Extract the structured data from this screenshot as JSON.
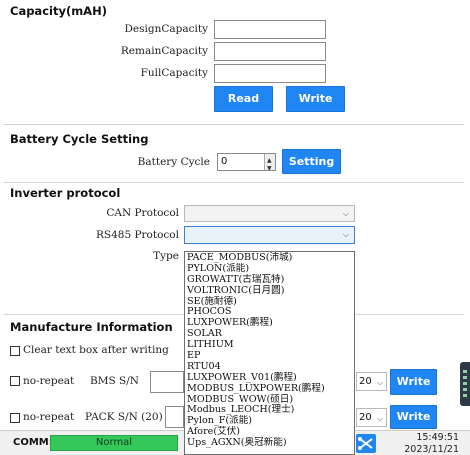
{
  "capacity": {
    "title": "Capacity(mAH)",
    "design_label": "DesignCapacity",
    "design_value": "",
    "remain_label": "RemainCapacity",
    "remain_value": "",
    "full_label": "FullCapacity",
    "full_value": "",
    "read_label": "Read",
    "write_label": "Write"
  },
  "cycle": {
    "title": "Battery Cycle Setting",
    "label": "Battery Cycle",
    "value": "0",
    "setting_label": "Setting"
  },
  "inverter": {
    "title": "Inverter protocol",
    "can_label": "CAN Protocol",
    "can_value": "",
    "rs485_label": "RS485 Protocol",
    "rs485_value": "",
    "type_label": "Type",
    "options": [
      "PACE_MODBUS(沛城)",
      "PYLON(派能)",
      "GROWATT(古瑞瓦特)",
      "VOLTRONIC(日月圆)",
      "SE(施耐德)",
      "PHOCOS",
      "LUXPOWER(鹏程)",
      "SOLAR",
      "LITHIUM",
      "EP",
      "RTU04",
      "LUXPOWER_V01(鹏程)",
      "MODBUS_LUXPOWER(鹏程)",
      "MODBUS_WOW(硕日)",
      "Modbus_LEOCH(理士)",
      "Pylon_F(派能)",
      "Afore(艾伏)",
      "Ups_AGXN(奥冠新能)"
    ]
  },
  "manufacture": {
    "title": "Manufacture Information",
    "clear_label": "Clear text box after writing",
    "norepeat_label": "no-repeat",
    "bms_sn_label": "BMS S/N",
    "bms_len": "20",
    "norepeat2_label": "no-repeat",
    "pack_sn_label": "PACK S/N (20)",
    "pack_len": "20",
    "write_label": "Write"
  },
  "status": {
    "comm_label": "COMM:",
    "comm_state": "Normal",
    "time": "15:49:51",
    "date": "2023/11/21"
  },
  "colors": {
    "accent": "#1f86f3",
    "normal": "#34c759"
  }
}
